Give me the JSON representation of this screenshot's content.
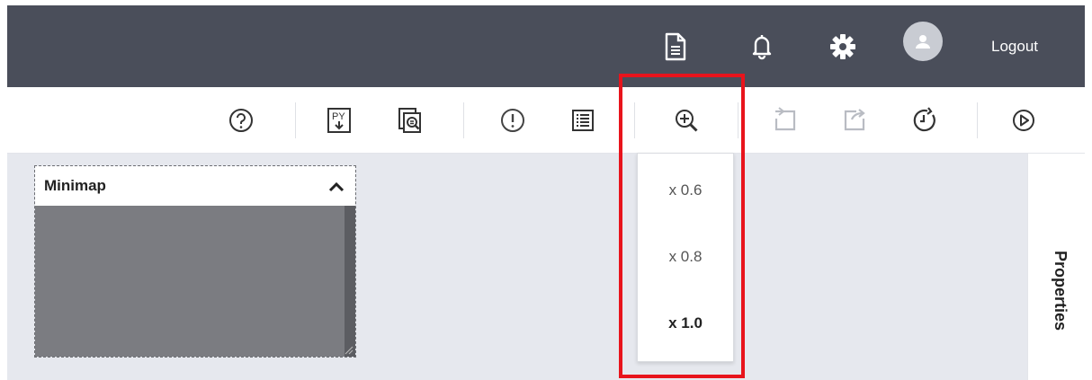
{
  "header": {
    "icons": [
      "document-icon",
      "bell-icon",
      "gear-icon",
      "user-avatar-icon"
    ],
    "logout_label": "Logout"
  },
  "toolbar": {
    "buttons": [
      "help-icon",
      "download-py-icon",
      "preview-icon",
      "warning-icon",
      "list-icon",
      "zoom-icon",
      "undo-icon",
      "redo-icon",
      "history-icon",
      "run-icon"
    ],
    "py_icon_text": "PY"
  },
  "minimap": {
    "title": "Minimap"
  },
  "zoom_menu": {
    "options": [
      {
        "label": "x 0.6",
        "selected": false
      },
      {
        "label": "x 0.8",
        "selected": false
      },
      {
        "label": "x 1.0",
        "selected": true
      }
    ]
  },
  "properties_panel": {
    "label": "Properties"
  },
  "colors": {
    "header_bg": "#4a4e5a",
    "canvas_bg": "#e6e8ee",
    "highlight": "#e8141c"
  }
}
